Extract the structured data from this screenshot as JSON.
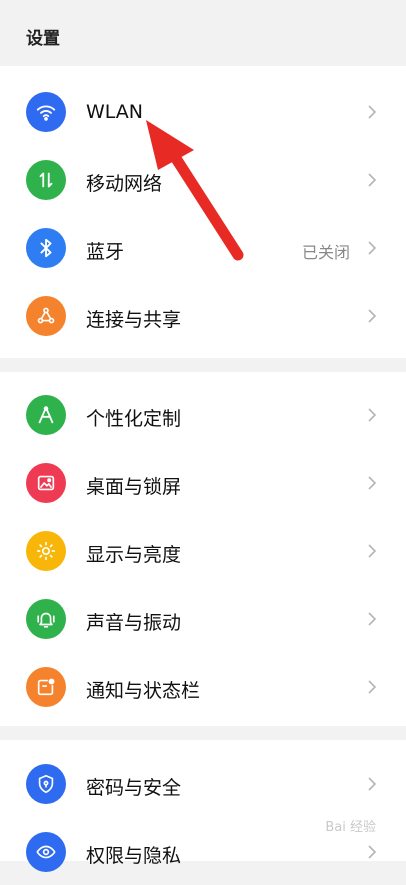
{
  "header": {
    "title": "设置"
  },
  "sections": [
    {
      "items": [
        {
          "label": "WLAN",
          "icon": "wifi-icon",
          "color": "#2F6BF0"
        },
        {
          "label": "移动网络",
          "icon": "mobile-data-icon",
          "color": "#2FB24C"
        },
        {
          "label": "蓝牙",
          "value": "已关闭",
          "icon": "bluetooth-icon",
          "color": "#2F7DF2"
        },
        {
          "label": "连接与共享",
          "icon": "share-network-icon",
          "color": "#F5822C"
        }
      ]
    },
    {
      "items": [
        {
          "label": "个性化定制",
          "icon": "personalize-icon",
          "color": "#2FB24C"
        },
        {
          "label": "桌面与锁屏",
          "icon": "wallpaper-icon",
          "color": "#EE3B53"
        },
        {
          "label": "显示与亮度",
          "icon": "brightness-icon",
          "color": "#F8B708"
        },
        {
          "label": "声音与振动",
          "icon": "bell-vibrate-icon",
          "color": "#2FB24C"
        },
        {
          "label": "通知与状态栏",
          "icon": "notification-icon",
          "color": "#F5822C"
        }
      ]
    },
    {
      "items": [
        {
          "label": "密码与安全",
          "icon": "shield-lock-icon",
          "color": "#2F6BF0"
        },
        {
          "label": "权限与隐私",
          "icon": "privacy-eye-icon",
          "color": "#2F6BF0"
        }
      ]
    }
  ],
  "watermark": "Bai 经验"
}
